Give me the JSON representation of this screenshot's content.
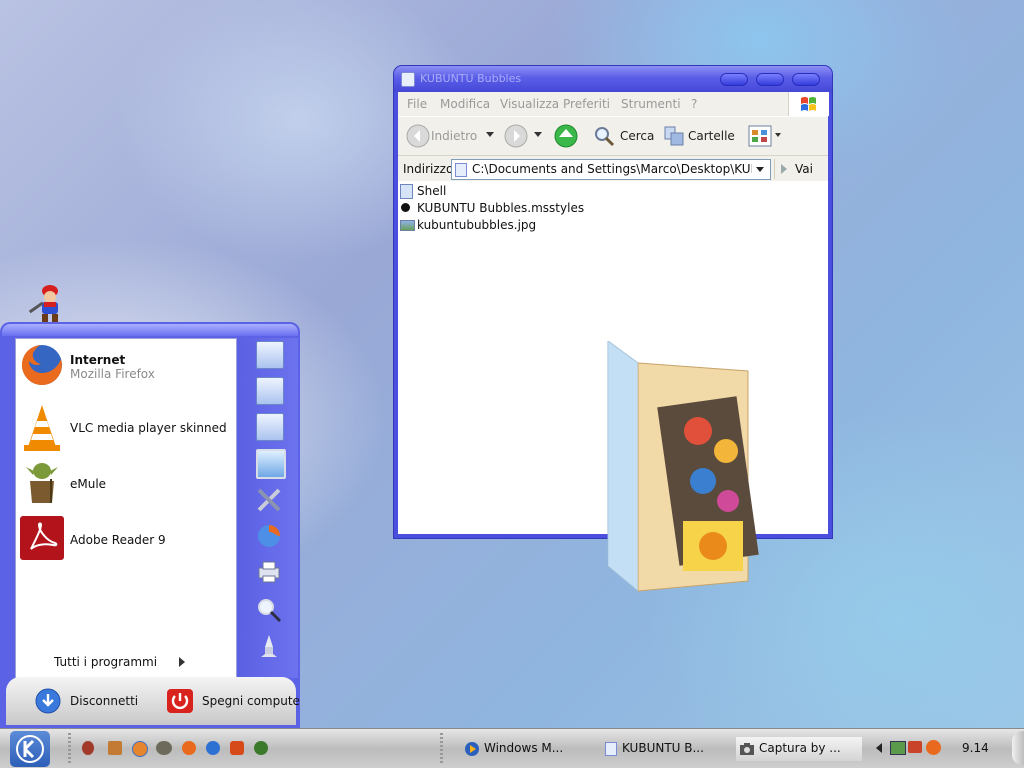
{
  "explorer": {
    "title": "KUBUNTU Bubbles",
    "menu": [
      "File",
      "Modifica",
      "Visualizza",
      "Preferiti",
      "Strumenti",
      "?"
    ],
    "toolbar": {
      "back": "Indietro",
      "search": "Cerca",
      "folders": "Cartelle"
    },
    "address": {
      "label": "Indirizzo",
      "value": "C:\\Documents and Settings\\Marco\\Desktop\\KUBUN",
      "go": "Vai"
    },
    "files": [
      {
        "name": "Shell",
        "icon": "folder-icon"
      },
      {
        "name": "KUBUNTU Bubbles.msstyles",
        "icon": "msstyles-file-icon"
      },
      {
        "name": "kubuntububbles.jpg",
        "icon": "image-file-icon"
      }
    ]
  },
  "start_menu": {
    "programs": [
      {
        "name": "Internet",
        "sub": "Mozilla Firefox",
        "icon": "firefox-icon"
      },
      {
        "name": "VLC media player skinned",
        "icon": "vlc-icon"
      },
      {
        "name": "eMule",
        "icon": "emule-icon"
      },
      {
        "name": "Adobe Reader 9",
        "icon": "adobe-reader-icon"
      }
    ],
    "all_programs": "Tutti i programmi",
    "logoff": "Disconnetti",
    "shutdown": "Spegni compute"
  },
  "taskbar": {
    "tasks": [
      "Windows M...",
      "KUBUNTU B...",
      "Captura by ..."
    ],
    "clock": "9.14"
  },
  "colors": {
    "window_frame": "#4b4fe0",
    "menu_bar": "#f1f0ea",
    "start_menu": "#5b62e6"
  }
}
